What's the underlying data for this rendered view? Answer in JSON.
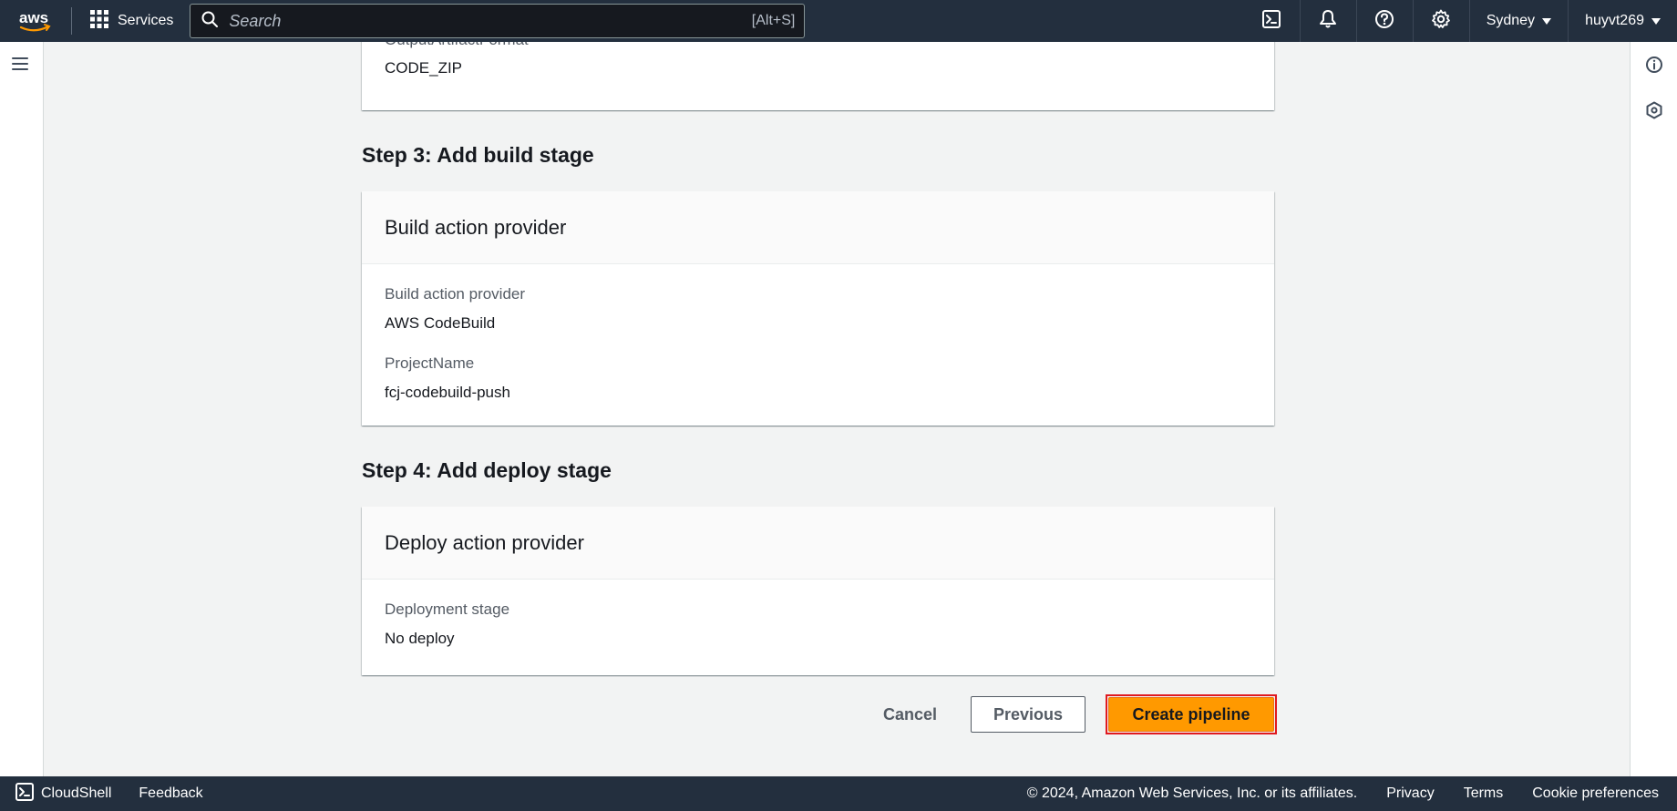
{
  "topnav": {
    "services_label": "Services",
    "search_placeholder": "Search",
    "search_shortcut": "[Alt+S]",
    "region": "Sydney",
    "user": "huyvt269"
  },
  "source_card": {
    "label": "OutputArtifactFormat",
    "value": "CODE_ZIP"
  },
  "step3": {
    "title": "Step 3: Add build stage",
    "card_title": "Build action provider",
    "fields": [
      {
        "label": "Build action provider",
        "value": "AWS CodeBuild"
      },
      {
        "label": "ProjectName",
        "value": "fcj-codebuild-push"
      }
    ]
  },
  "step4": {
    "title": "Step 4: Add deploy stage",
    "card_title": "Deploy action provider",
    "fields": [
      {
        "label": "Deployment stage",
        "value": "No deploy"
      }
    ]
  },
  "actions": {
    "cancel": "Cancel",
    "previous": "Previous",
    "create": "Create pipeline"
  },
  "footer": {
    "cloudshell": "CloudShell",
    "feedback": "Feedback",
    "copyright": "© 2024, Amazon Web Services, Inc. or its affiliates.",
    "privacy": "Privacy",
    "terms": "Terms",
    "cookies": "Cookie preferences"
  },
  "colors": {
    "nav_bg": "#232f3e",
    "primary_button": "#ff9900",
    "highlight_border": "#e0191f",
    "page_bg": "#f2f3f3"
  }
}
